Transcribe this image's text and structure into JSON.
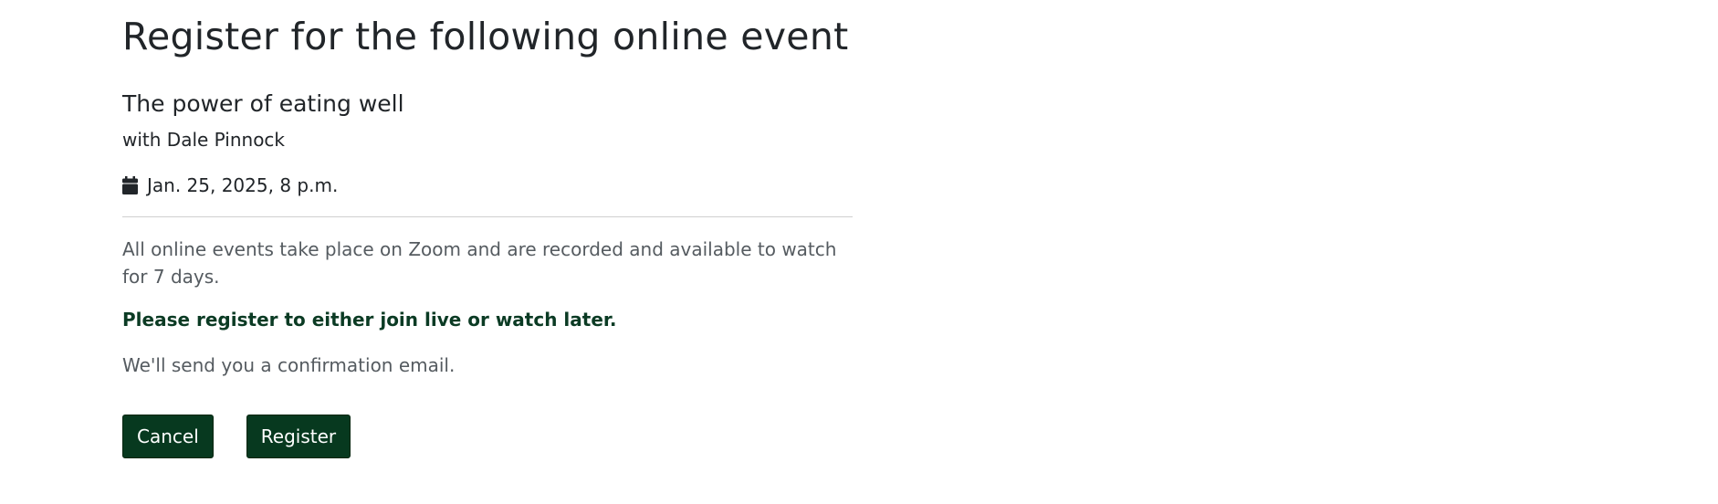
{
  "page": {
    "heading": "Register for the following online event"
  },
  "event": {
    "title": "The power of eating well",
    "host": "with Dale Pinnock",
    "date": "Jan. 25, 2025, 8 p.m."
  },
  "notes": {
    "info": "All online events take place on Zoom and are recorded and available to watch for 7 days.",
    "emphasis": "Please register to either join live or watch later.",
    "confirmation": "We'll send you a confirmation email."
  },
  "actions": {
    "cancel_label": "Cancel",
    "register_label": "Register"
  },
  "icons": {
    "date_icon": "calendar-icon"
  },
  "colors": {
    "primary_button": "#07391f",
    "emphasis_text": "#0b3b24"
  }
}
